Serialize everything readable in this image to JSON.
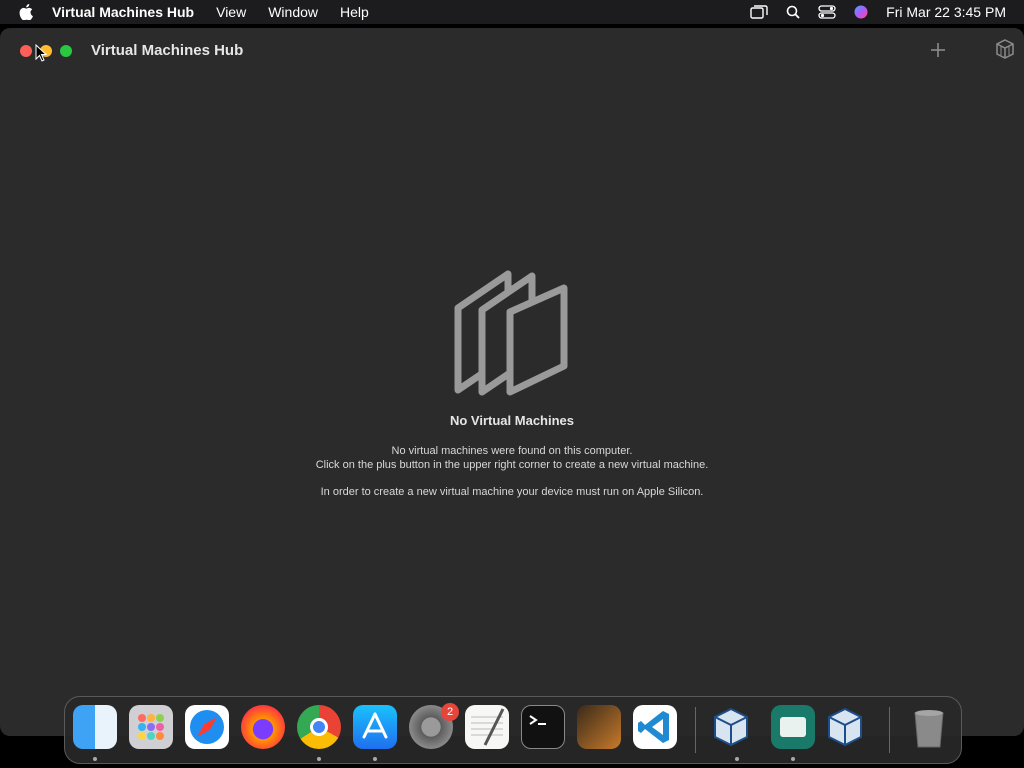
{
  "menubar": {
    "app_name": "Virtual Machines Hub",
    "items": [
      "View",
      "Window",
      "Help"
    ],
    "clock": "Fri Mar 22  3:45 PM"
  },
  "window": {
    "title": "Virtual Machines Hub"
  },
  "empty_state": {
    "title": "No Virtual Machines",
    "line1": "No virtual machines were found on this computer.",
    "line2": "Click on the plus button in the upper right corner to create a new virtual machine.",
    "line3": "In order to create a new virtual machine your device must run on Apple Silicon."
  },
  "dock": {
    "settings_badge": "2",
    "apps": [
      "finder",
      "launchpad",
      "safari",
      "firefox",
      "chrome",
      "app-store",
      "system-settings",
      "textedit",
      "terminal",
      "garageband",
      "vscode",
      "virtualbox",
      "unknown-green-app",
      "virtualbox-2",
      "trash"
    ]
  },
  "icons": [
    "apple-icon",
    "screen-mirror-icon",
    "search-icon",
    "control-center-icon",
    "siri-icon",
    "plus-icon",
    "cube-icon",
    "vm-stack-icon"
  ]
}
